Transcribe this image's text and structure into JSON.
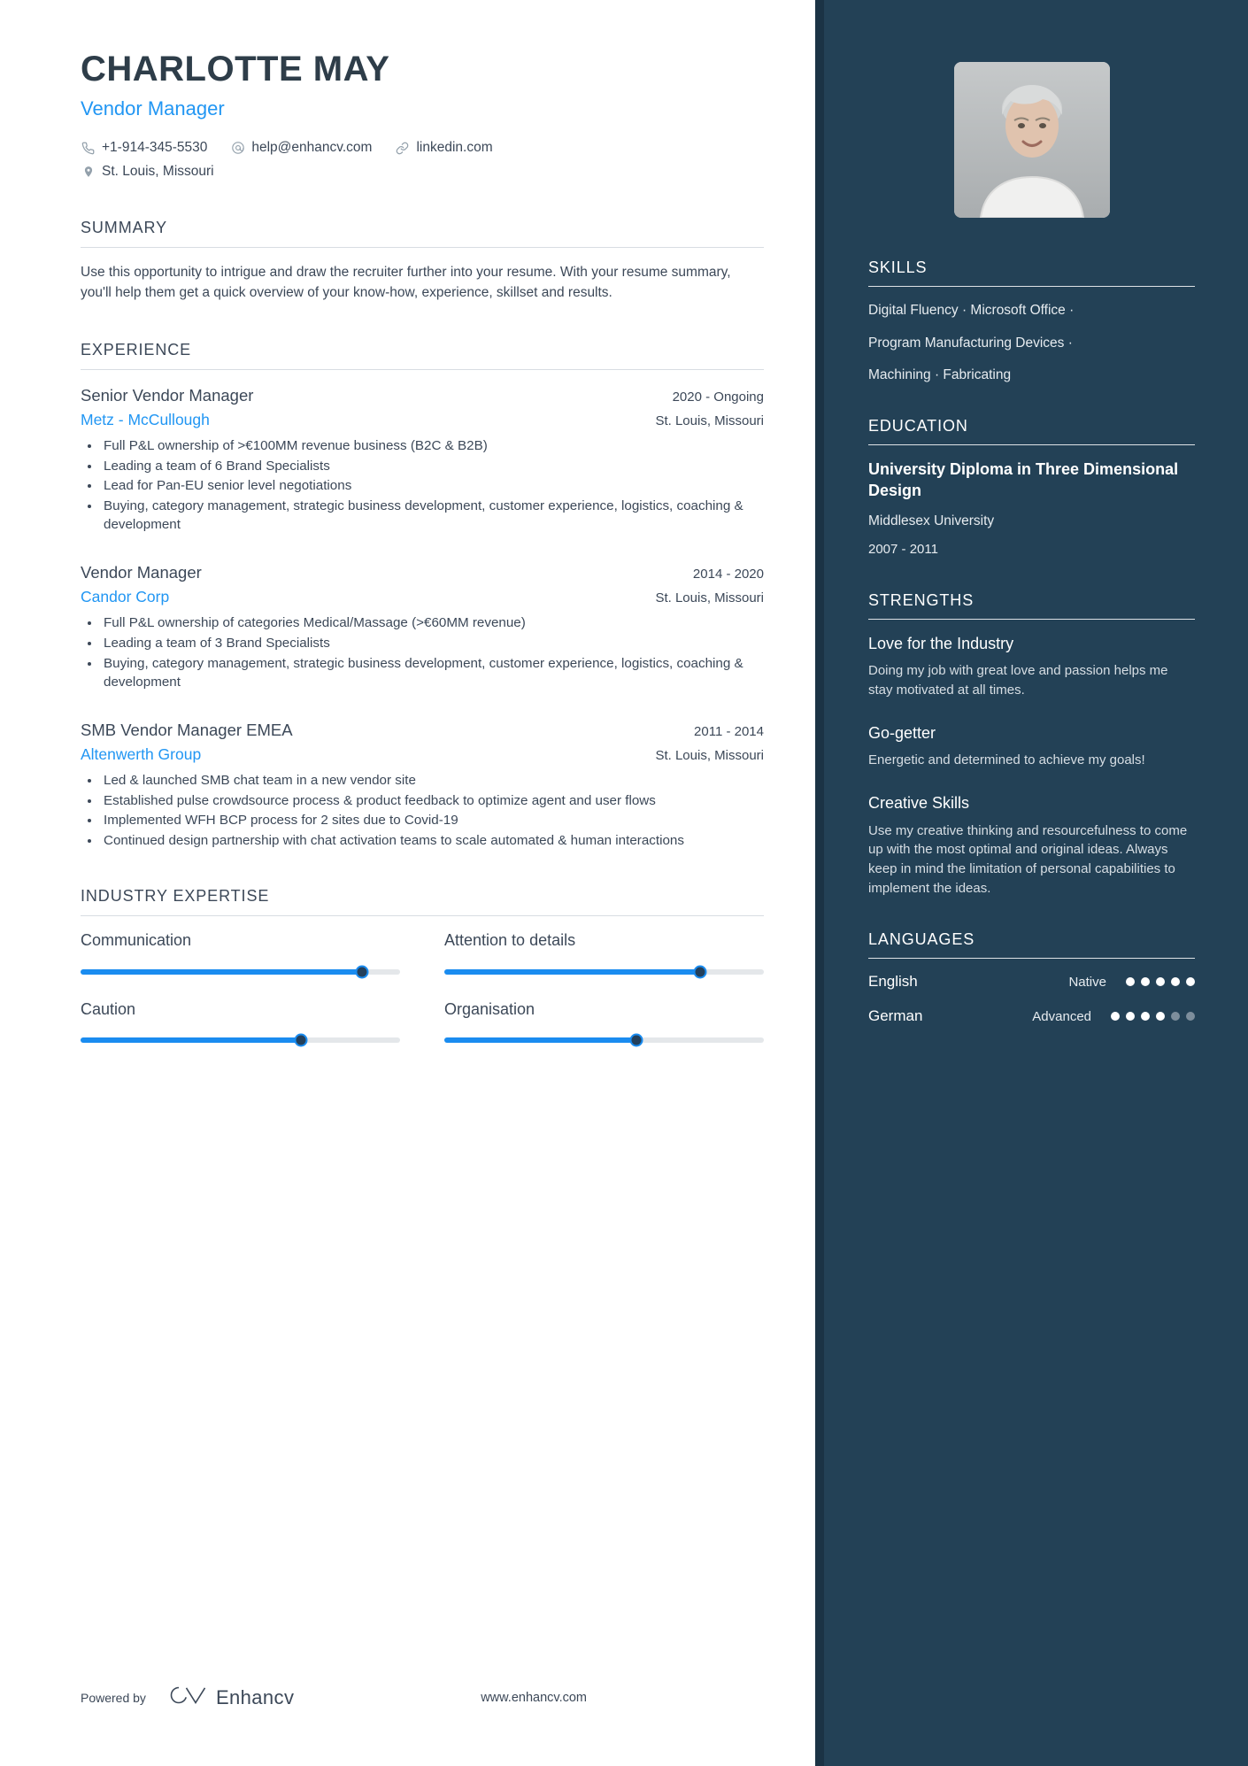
{
  "header": {
    "name": "CHARLOTTE MAY",
    "job_title": "Vendor Manager",
    "contacts": [
      {
        "icon": "phone-icon",
        "text": "+1-914-345-5530"
      },
      {
        "icon": "email-icon",
        "text": "help@enhancv.com"
      },
      {
        "icon": "link-icon",
        "text": "linkedin.com"
      }
    ],
    "location": {
      "icon": "map-pin-icon",
      "text": "St. Louis, Missouri"
    }
  },
  "summary": {
    "title": "SUMMARY",
    "text": "Use this opportunity to intrigue and draw the recruiter further into your resume. With your resume summary, you'll help them get a quick overview of your know-how, experience, skillset and results."
  },
  "experience": {
    "title": "EXPERIENCE",
    "entries": [
      {
        "role": "Senior Vendor Manager",
        "dates": "2020 - Ongoing",
        "company": "Metz - McCullough",
        "location": "St. Louis, Missouri",
        "bullets": [
          "Full P&L ownership of >€100MM revenue business (B2C & B2B)",
          "Leading a team of 6 Brand Specialists",
          "Lead for Pan-EU senior level negotiations",
          "Buying, category management, strategic business development, customer experience, logistics, coaching & development"
        ]
      },
      {
        "role": "Vendor Manager",
        "dates": "2014 - 2020",
        "company": "Candor Corp",
        "location": "St. Louis, Missouri",
        "bullets": [
          "Full P&L ownership of categories Medical/Massage (>€60MM revenue)",
          "Leading a team of 3 Brand Specialists",
          "Buying, category management, strategic business development, customer experience, logistics, coaching & development"
        ]
      },
      {
        "role": "SMB Vendor Manager EMEA",
        "dates": "2011 - 2014",
        "company": "Altenwerth Group",
        "location": "St. Louis, Missouri",
        "bullets": [
          "Led & launched SMB chat team in a new vendor site",
          "Established pulse crowdsource process & product feedback to optimize agent and user flows",
          "Implemented WFH BCP process for 2 sites due to Covid-19",
          "Continued design partnership with chat activation teams to scale automated & human interactions"
        ]
      }
    ]
  },
  "industry_expertise": {
    "title": "INDUSTRY EXPERTISE",
    "items": [
      {
        "label": "Communication",
        "value": 88
      },
      {
        "label": "Attention to details",
        "value": 80
      },
      {
        "label": "Caution",
        "value": 69
      },
      {
        "label": "Organisation",
        "value": 60
      }
    ]
  },
  "sidebar": {
    "skills": {
      "title": "SKILLS",
      "lines": [
        "Digital Fluency · Microsoft Office ·",
        "Program Manufacturing Devices ·",
        "Machining · Fabricating"
      ]
    },
    "education": {
      "title": "EDUCATION",
      "degree": "University Diploma in Three Dimensional Design",
      "school": "Middlesex University",
      "dates": "2007 - 2011"
    },
    "strengths": {
      "title": "STRENGTHS",
      "items": [
        {
          "name": "Love for the Industry",
          "description": "Doing my job with great love and passion helps me stay motivated at all times."
        },
        {
          "name": "Go-getter",
          "description": "Energetic and determined to achieve my goals!"
        },
        {
          "name": "Creative Skills",
          "description": "Use my creative thinking and resourcefulness to come up with the most optimal and original ideas. Always keep in mind the limitation of personal capabilities to implement the ideas."
        }
      ]
    },
    "languages": {
      "title": "LANGUAGES",
      "items": [
        {
          "name": "English",
          "level": "Native",
          "filled": 5,
          "total": 5
        },
        {
          "name": "German",
          "level": "Advanced",
          "filled": 4,
          "total": 6
        }
      ]
    }
  },
  "footer": {
    "powered_by": "Powered by",
    "brand": "Enhancv",
    "url": "www.enhancv.com"
  },
  "colors": {
    "accent_blue": "#2196f3",
    "sidebar_bg": "#234156",
    "sidebar_edge": "#1b3345",
    "text_dark": "#3c4858",
    "slider_fill": "#1a8cf0",
    "slider_track": "#e4e7ea"
  }
}
